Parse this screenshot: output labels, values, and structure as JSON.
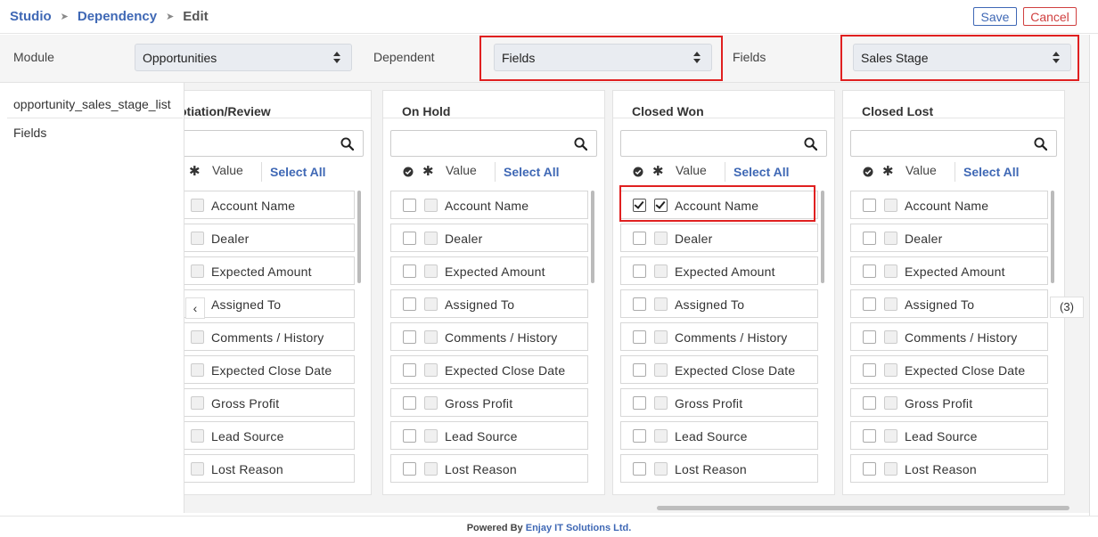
{
  "breadcrumb": {
    "items": [
      "Studio",
      "Dependency"
    ],
    "current": "Edit",
    "separator": "➤"
  },
  "actions": {
    "save_label": "Save",
    "cancel_label": "Cancel"
  },
  "selectors": {
    "module_label": "Module",
    "module_value": "Opportunities",
    "dependent_label": "Dependent",
    "dependent_value": "Fields",
    "fields_label": "Fields",
    "fields_value": "Sales Stage"
  },
  "sidebar": {
    "items": [
      {
        "label": "opportunity_sales_stage_list"
      },
      {
        "label": "Fields"
      }
    ]
  },
  "column_header": {
    "value_label": "Value",
    "select_all_label": "Select All",
    "star": "✱"
  },
  "columns": [
    {
      "title": "otiation/Review",
      "rows": [
        {
          "label": "Account Name",
          "checked": false,
          "checked2": false
        },
        {
          "label": "Dealer",
          "checked": false,
          "checked2": false
        },
        {
          "label": "Expected Amount",
          "checked": false,
          "checked2": false
        },
        {
          "label": "Assigned To",
          "checked": false,
          "checked2": false
        },
        {
          "label": "Comments / History",
          "checked": false,
          "checked2": false
        },
        {
          "label": "Expected Close Date",
          "checked": false,
          "checked2": false
        },
        {
          "label": "Gross Profit",
          "checked": false,
          "checked2": false
        },
        {
          "label": "Lead Source",
          "checked": false,
          "checked2": false
        },
        {
          "label": "Lost Reason",
          "checked": false,
          "checked2": false
        }
      ]
    },
    {
      "title": "On Hold",
      "rows": [
        {
          "label": "Account Name",
          "checked": false,
          "checked2": false
        },
        {
          "label": "Dealer",
          "checked": false,
          "checked2": false
        },
        {
          "label": "Expected Amount",
          "checked": false,
          "checked2": false
        },
        {
          "label": "Assigned To",
          "checked": false,
          "checked2": false
        },
        {
          "label": "Comments / History",
          "checked": false,
          "checked2": false
        },
        {
          "label": "Expected Close Date",
          "checked": false,
          "checked2": false
        },
        {
          "label": "Gross Profit",
          "checked": false,
          "checked2": false
        },
        {
          "label": "Lead Source",
          "checked": false,
          "checked2": false
        },
        {
          "label": "Lost Reason",
          "checked": false,
          "checked2": false
        }
      ]
    },
    {
      "title": "Closed Won",
      "rows": [
        {
          "label": "Account Name",
          "checked": true,
          "checked2": true
        },
        {
          "label": "Dealer",
          "checked": false,
          "checked2": false
        },
        {
          "label": "Expected Amount",
          "checked": false,
          "checked2": false
        },
        {
          "label": "Assigned To",
          "checked": false,
          "checked2": false
        },
        {
          "label": "Comments / History",
          "checked": false,
          "checked2": false
        },
        {
          "label": "Expected Close Date",
          "checked": false,
          "checked2": false
        },
        {
          "label": "Gross Profit",
          "checked": false,
          "checked2": false
        },
        {
          "label": "Lead Source",
          "checked": false,
          "checked2": false
        },
        {
          "label": "Lost Reason",
          "checked": false,
          "checked2": false
        }
      ]
    },
    {
      "title": "Closed Lost",
      "rows": [
        {
          "label": "Account Name",
          "checked": false,
          "checked2": false
        },
        {
          "label": "Dealer",
          "checked": false,
          "checked2": false
        },
        {
          "label": "Expected Amount",
          "checked": false,
          "checked2": false
        },
        {
          "label": "Assigned To",
          "checked": false,
          "checked2": false
        },
        {
          "label": "Comments / History",
          "checked": false,
          "checked2": false
        },
        {
          "label": "Expected Close Date",
          "checked": false,
          "checked2": false
        },
        {
          "label": "Gross Profit",
          "checked": false,
          "checked2": false
        },
        {
          "label": "Lead Source",
          "checked": false,
          "checked2": false
        },
        {
          "label": "Lost Reason",
          "checked": false,
          "checked2": false
        }
      ]
    }
  ],
  "pager": {
    "prev_label": "‹",
    "count_label": "(3)"
  },
  "footer": {
    "prefix": "Powered By ",
    "brand": "Enjay IT Solutions Ltd."
  },
  "colors": {
    "accent": "#3f68b5",
    "danger": "#d04040",
    "highlight": "#e02020"
  }
}
